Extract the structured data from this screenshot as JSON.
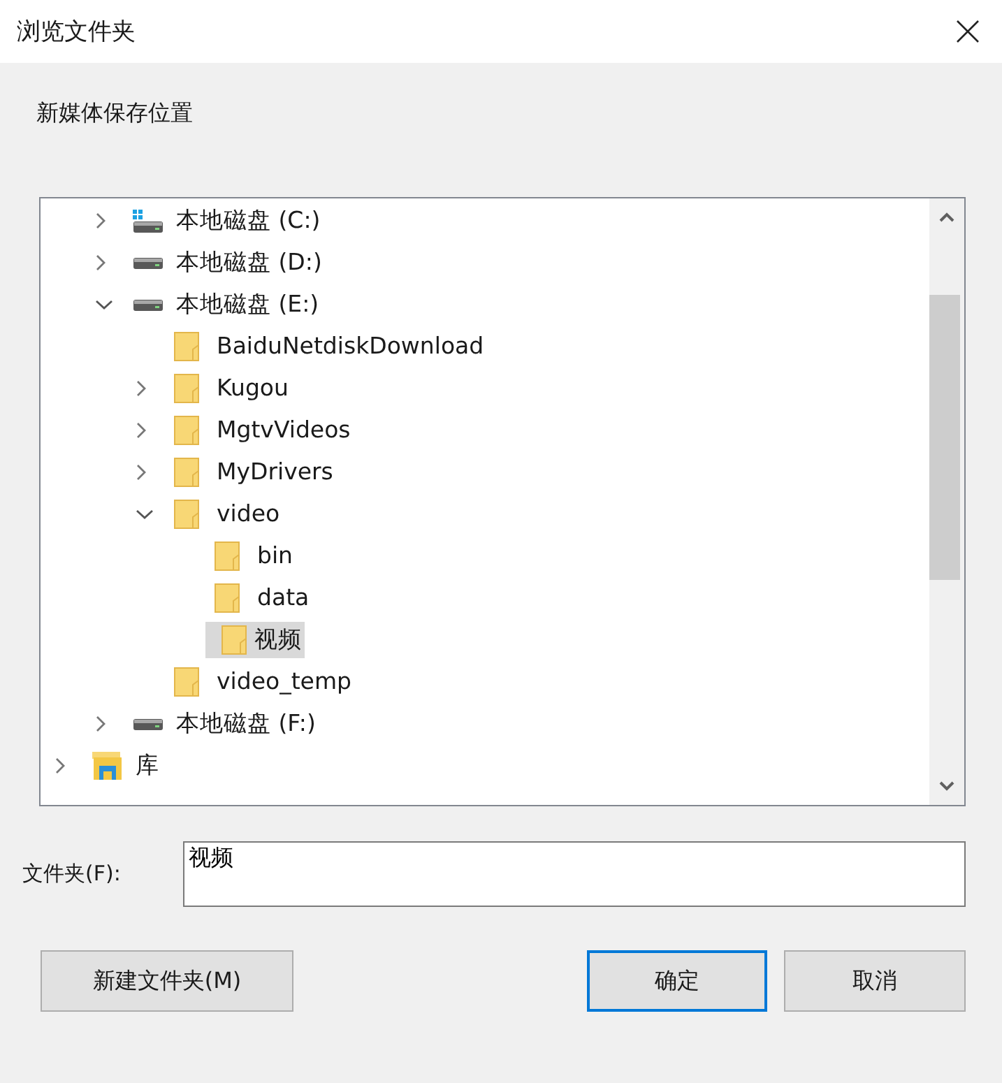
{
  "window": {
    "title": "浏览文件夹"
  },
  "description": "新媒体保存位置",
  "tree": [
    {
      "label": "本地磁盘 (C:)",
      "kind": "system_drive",
      "expanded": false,
      "selected": false
    },
    {
      "label": "本地磁盘 (D:)",
      "kind": "drive",
      "expanded": false,
      "selected": false
    },
    {
      "label": "本地磁盘 (E:)",
      "kind": "drive",
      "expanded": true,
      "selected": false,
      "children": [
        {
          "label": "BaiduNetdiskDownload",
          "kind": "folder",
          "selected": false
        },
        {
          "label": "Kugou",
          "kind": "folder",
          "expanded": false,
          "selected": false
        },
        {
          "label": "MgtvVideos",
          "kind": "folder",
          "expanded": false,
          "selected": false
        },
        {
          "label": "MyDrivers",
          "kind": "folder",
          "expanded": false,
          "selected": false
        },
        {
          "label": "video",
          "kind": "folder",
          "expanded": true,
          "selected": false,
          "children": [
            {
              "label": "bin",
              "kind": "folder",
              "selected": false
            },
            {
              "label": "data",
              "kind": "folder",
              "selected": false
            },
            {
              "label": "视频",
              "kind": "folder",
              "selected": true
            }
          ]
        },
        {
          "label": "video_temp",
          "kind": "folder",
          "selected": false
        }
      ]
    },
    {
      "label": "本地磁盘 (F:)",
      "kind": "drive",
      "expanded": false,
      "selected": false
    },
    {
      "label": "库",
      "kind": "library",
      "expanded": false,
      "selected": false,
      "root": true
    }
  ],
  "folder_field": {
    "label": "文件夹(F):",
    "value": "视频"
  },
  "buttons": [
    {
      "label": "新建文件夹(M)",
      "kind": "secondary"
    },
    {
      "label": "确定",
      "kind": "default"
    },
    {
      "label": "取消",
      "kind": "secondary"
    }
  ]
}
